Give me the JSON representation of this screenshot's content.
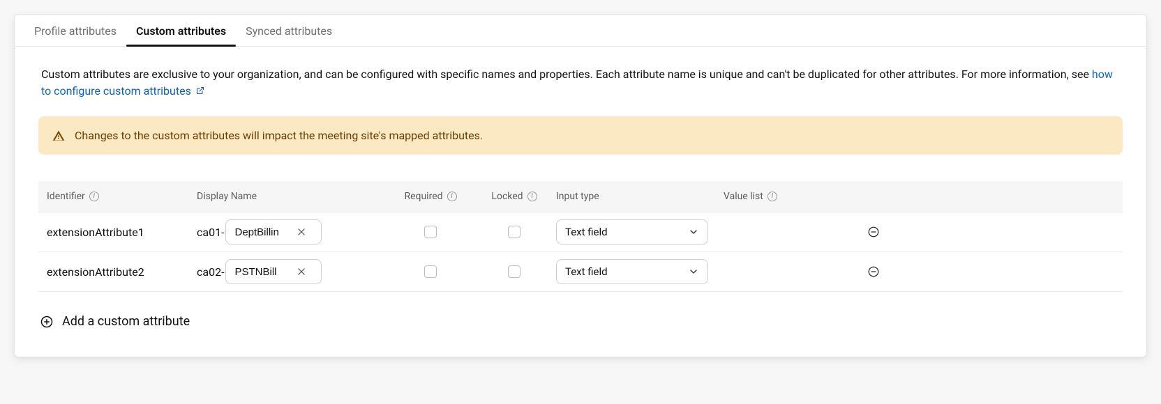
{
  "tabs": {
    "profile": "Profile attributes",
    "custom": "Custom attributes",
    "synced": "Synced attributes"
  },
  "description": {
    "text": "Custom attributes are exclusive to your organization, and can be configured with specific names and properties. Each attribute name is unique and can't be duplicated for other attributes. For more information, see ",
    "link": "how to configure custom attributes"
  },
  "alert": {
    "text": "Changes to the custom attributes will impact the meeting site's mapped attributes."
  },
  "table": {
    "headers": {
      "identifier": "Identifier",
      "display_name": "Display Name",
      "required": "Required",
      "locked": "Locked",
      "input_type": "Input type",
      "value_list": "Value list"
    },
    "rows": [
      {
        "identifier": "extensionAttribute1",
        "prefix": "ca01-",
        "name_value": "DeptBillin",
        "required": false,
        "locked": false,
        "input_type": "Text field"
      },
      {
        "identifier": "extensionAttribute2",
        "prefix": "ca02-",
        "name_value": "PSTNBill",
        "required": false,
        "locked": false,
        "input_type": "Text field"
      }
    ]
  },
  "add_label": "Add a custom attribute"
}
